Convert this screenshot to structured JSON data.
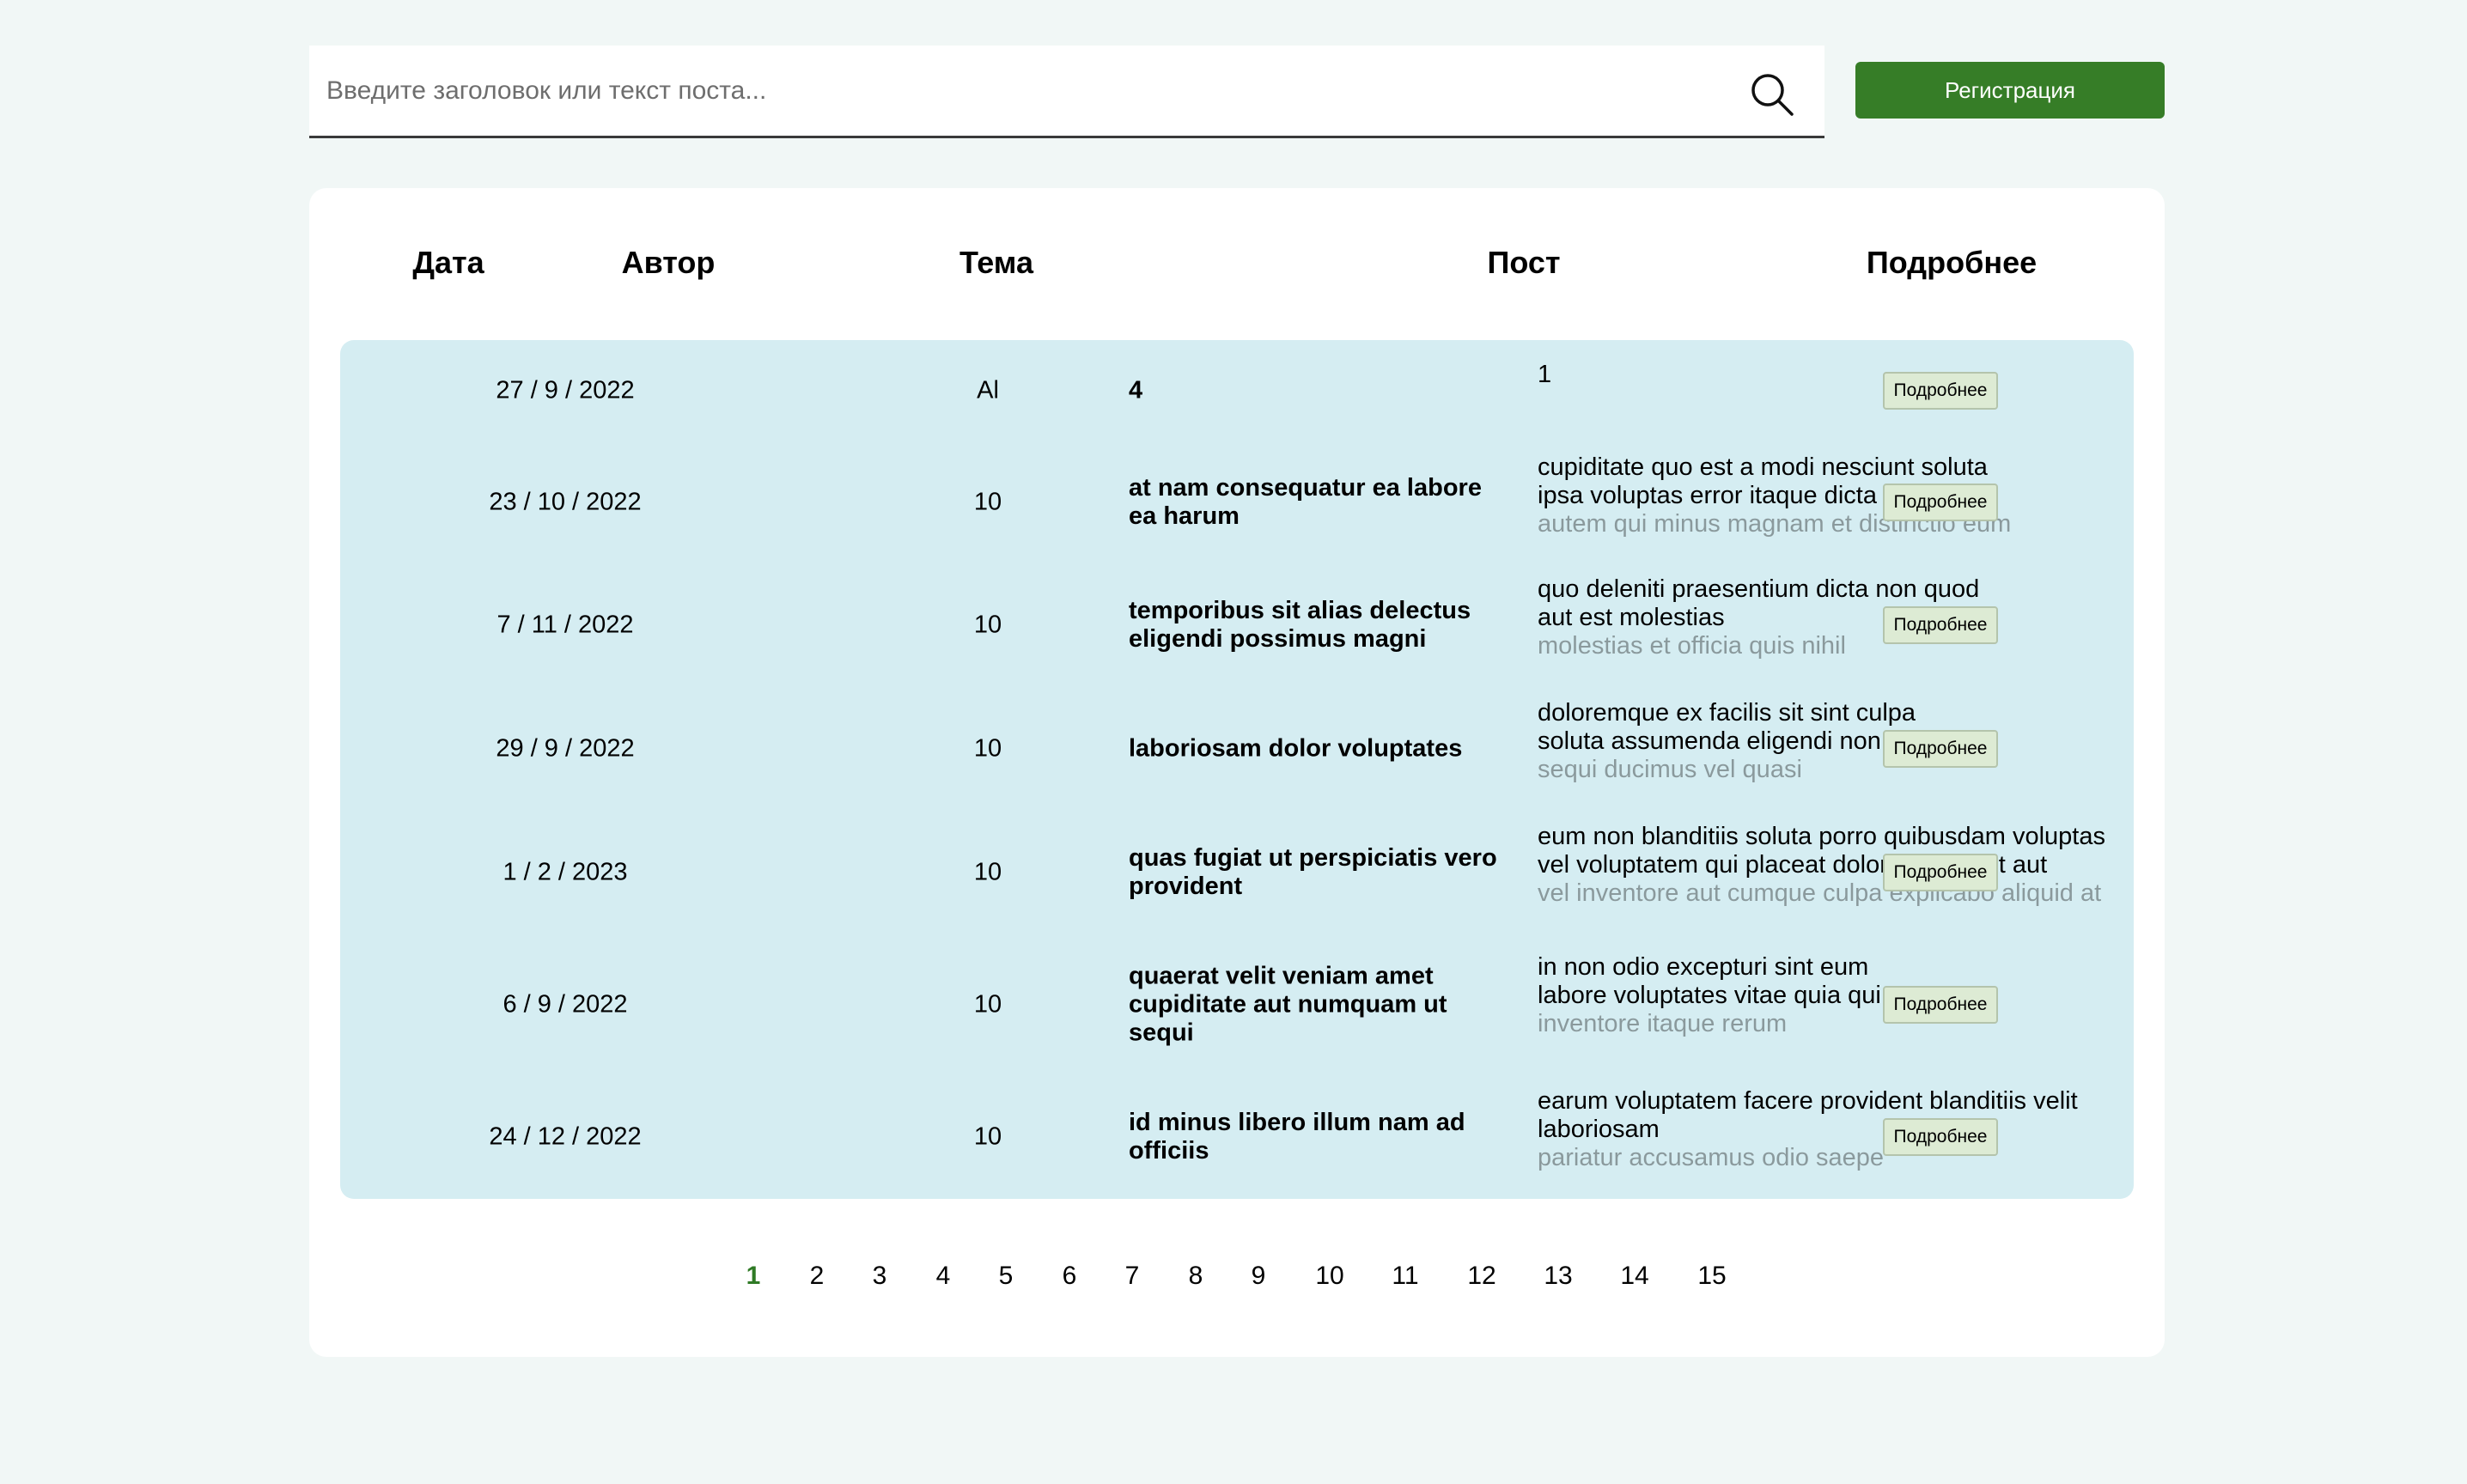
{
  "search": {
    "placeholder": "Введите заголовок или текст поста...",
    "value": ""
  },
  "header": {
    "register_label": "Регистрация"
  },
  "table": {
    "columns": [
      "Дата",
      "Автор",
      "Тема",
      "Пост",
      "Подробнее"
    ],
    "details_label": "Подробнее",
    "rows": [
      {
        "date": "27 / 9 / 2022",
        "author": "Al",
        "topic": "4",
        "post": [
          "1"
        ]
      },
      {
        "date": "23 / 10 / 2022",
        "author": "10",
        "topic": "at nam consequatur ea labore ea harum",
        "post": [
          "cupiditate quo est a modi nesciunt soluta",
          "ipsa voluptas error itaque dicta in",
          "autem qui minus magnam et distinctio eum"
        ]
      },
      {
        "date": "7 / 11 / 2022",
        "author": "10",
        "topic": "temporibus sit alias delectus eligendi possimus magni",
        "post": [
          "quo deleniti praesentium dicta non quod",
          "aut est molestias",
          "molestias et officia quis nihil"
        ]
      },
      {
        "date": "29 / 9 / 2022",
        "author": "10",
        "topic": "laboriosam dolor voluptates",
        "post": [
          "doloremque ex facilis sit sint culpa",
          "soluta assumenda eligendi non ut eius",
          "sequi ducimus vel quasi"
        ]
      },
      {
        "date": "1 / 2 / 2023",
        "author": "10",
        "topic": "quas fugiat ut perspiciatis vero provident",
        "post": [
          "eum non blanditiis soluta porro quibusdam voluptas",
          "vel voluptatem qui placeat dolores qui velit aut",
          "vel inventore aut cumque culpa explicabo aliquid at"
        ]
      },
      {
        "date": "6 / 9 / 2022",
        "author": "10",
        "topic": "quaerat velit veniam amet cupiditate aut numquam ut sequi",
        "post": [
          "in non odio excepturi sint eum",
          "labore voluptates vitae quia qui et",
          "inventore itaque rerum"
        ]
      },
      {
        "date": "24 / 12 / 2022",
        "author": "10",
        "topic": "id minus libero illum nam ad officiis",
        "post": [
          "earum voluptatem facere provident blanditiis velit",
          "laboriosam",
          "pariatur accusamus odio saepe"
        ]
      }
    ]
  },
  "pagination": {
    "pages": [
      "1",
      "2",
      "3",
      "4",
      "5",
      "6",
      "7",
      "8",
      "9",
      "10",
      "11",
      "12",
      "13",
      "14",
      "15"
    ],
    "current": "1"
  },
  "colors": {
    "page_background": "#f1f7f6",
    "accent_green": "#367d27",
    "table_body": "#d5edf2",
    "details_button": "#ddebd4",
    "active_page": "#2f7a25"
  }
}
